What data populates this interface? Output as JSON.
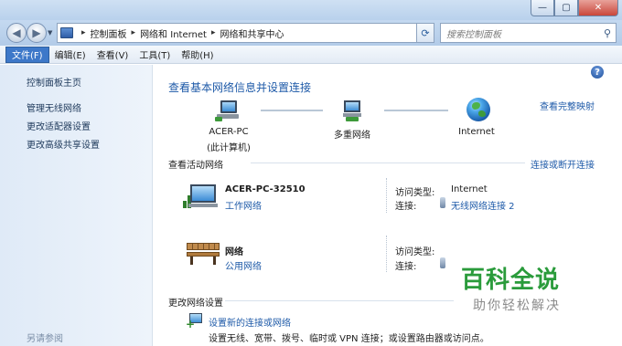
{
  "window": {
    "minimize_glyph": "—",
    "maximize_glyph": "▢",
    "close_glyph": "✕"
  },
  "addressbar": {
    "crumbs": [
      "控制面板",
      "网络和 Internet",
      "网络和共享中心"
    ],
    "search_placeholder": "搜索控制面板"
  },
  "menu": {
    "items": [
      "文件(F)",
      "编辑(E)",
      "查看(V)",
      "工具(T)",
      "帮助(H)"
    ]
  },
  "sidebar": {
    "items": [
      "控制面板主页",
      "管理无线网络",
      "更改适配器设置",
      "更改高级共享设置"
    ],
    "see_also": "另请参阅"
  },
  "main": {
    "heading": "查看基本网络信息并设置连接",
    "full_map": "查看完整映射",
    "map": {
      "pc_name": "ACER-PC",
      "pc_sub": "(此计算机)",
      "middle": "多重网络",
      "internet": "Internet"
    },
    "active_section": "查看活动网络",
    "connect_link": "连接或断开连接",
    "networks": [
      {
        "name": "ACER-PC-32510",
        "type": "工作网络",
        "access_label": "访问类型:",
        "access_value": "Internet",
        "conn_label": "连接:",
        "conn_value": "无线网络连接 2"
      },
      {
        "name": "网络",
        "type": "公用网络",
        "access_label": "访问类型:",
        "access_value": "",
        "conn_label": "连接:",
        "conn_value": ""
      }
    ],
    "change_section": "更改网络设置",
    "setup_link": "设置新的连接或网络",
    "setup_desc": "设置无线、宽带、拨号、临时或 VPN 连接；或设置路由器或访问点。"
  },
  "watermark": {
    "big": "百科全说",
    "small": "助你轻松解决"
  }
}
